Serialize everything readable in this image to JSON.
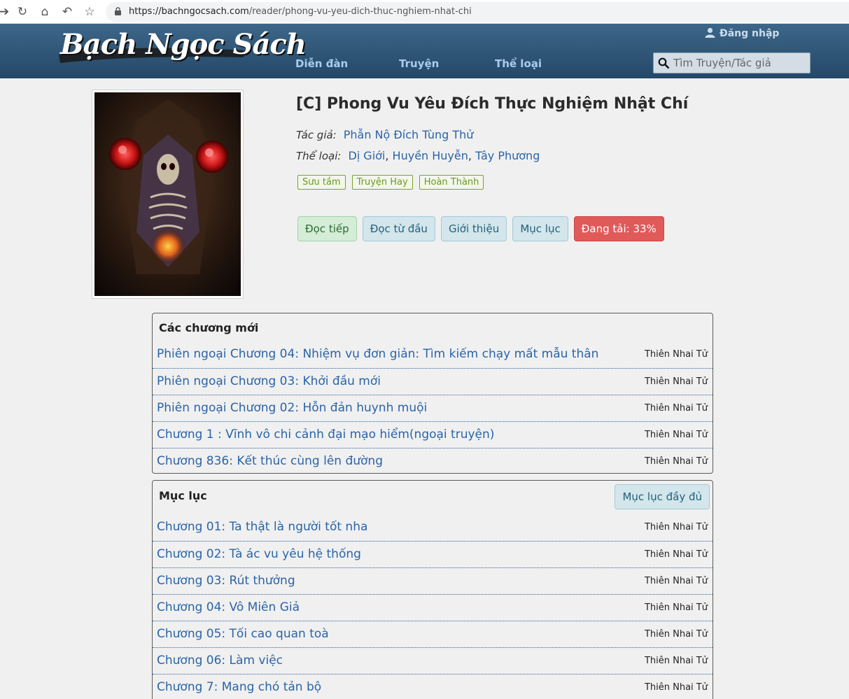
{
  "browser": {
    "url_host": "https://bachngocsach.com",
    "url_path": "/reader/phong-vu-yeu-dich-thuc-nghiem-nhat-chi"
  },
  "header": {
    "logo_text": "Bạch Ngọc Sách",
    "nav": [
      "Diễn đàn",
      "Truyện",
      "Thể loại"
    ],
    "login_label": "Đăng nhập",
    "search_placeholder": "Tìm Truyện/Tác giả"
  },
  "book": {
    "title": "[C] Phong Vu Yêu Đích Thực Nghiệm Nhật Chí",
    "author_label": "Tác giả:",
    "author": "Phẫn Nộ Đích Tùng Thử",
    "genre_label": "Thể loại:",
    "genres": [
      "Dị Giới",
      "Huyền Huyễn",
      "Tây Phương"
    ],
    "tags": [
      "Sưu tầm",
      "Truyện Hay",
      "Hoàn Thành"
    ],
    "actions": {
      "continue": "Đọc tiếp",
      "from_start": "Đọc từ đầu",
      "intro": "Giới thiệu",
      "toc": "Mục lục",
      "loading": "Đang tải: 33%"
    },
    "loading_percent": 33
  },
  "latest": {
    "title": "Các chương mới",
    "chapters": [
      {
        "title": "Phiên ngoại Chương 04: Nhiệm vụ đơn giản: Tìm kiếm chạy mất mẫu thân",
        "author": "Thiên Nhai Tử"
      },
      {
        "title": "Phiên ngoại Chương 03: Khởi đầu mới",
        "author": "Thiên Nhai Tử"
      },
      {
        "title": "Phiên ngoại Chương 02: Hỗn đản huynh muội",
        "author": "Thiên Nhai Tử"
      },
      {
        "title": "Chương 1 : Vĩnh vô chi cảnh đại mạo hiểm(ngoại truyện)",
        "author": "Thiên Nhai Tử"
      },
      {
        "title": "Chương 836: Kết thúc cùng lên đường",
        "author": "Thiên Nhai Tử"
      }
    ]
  },
  "toc": {
    "title": "Mục lục",
    "full_label": "Mục lục đầy đủ",
    "chapters": [
      {
        "title": "Chương 01: Ta thật là người tốt nha",
        "author": "Thiên Nhai Tử"
      },
      {
        "title": "Chương 02: Tà ác vu yêu hệ thống",
        "author": "Thiên Nhai Tử"
      },
      {
        "title": "Chương 03: Rút thưởng",
        "author": "Thiên Nhai Tử"
      },
      {
        "title": "Chương 04: Vô Miên Giả",
        "author": "Thiên Nhai Tử"
      },
      {
        "title": "Chương 05: Tối cao quan toà",
        "author": "Thiên Nhai Tử"
      },
      {
        "title": "Chương 06: Làm việc",
        "author": "Thiên Nhai Tử"
      },
      {
        "title": "Chương 7: Mang chó tản bộ",
        "author": "Thiên Nhai Tử"
      }
    ]
  },
  "colors": {
    "header_top": "#3d6688",
    "header_bottom": "#244868",
    "link": "#2a64a8",
    "loading_button": "#e05a5a"
  }
}
